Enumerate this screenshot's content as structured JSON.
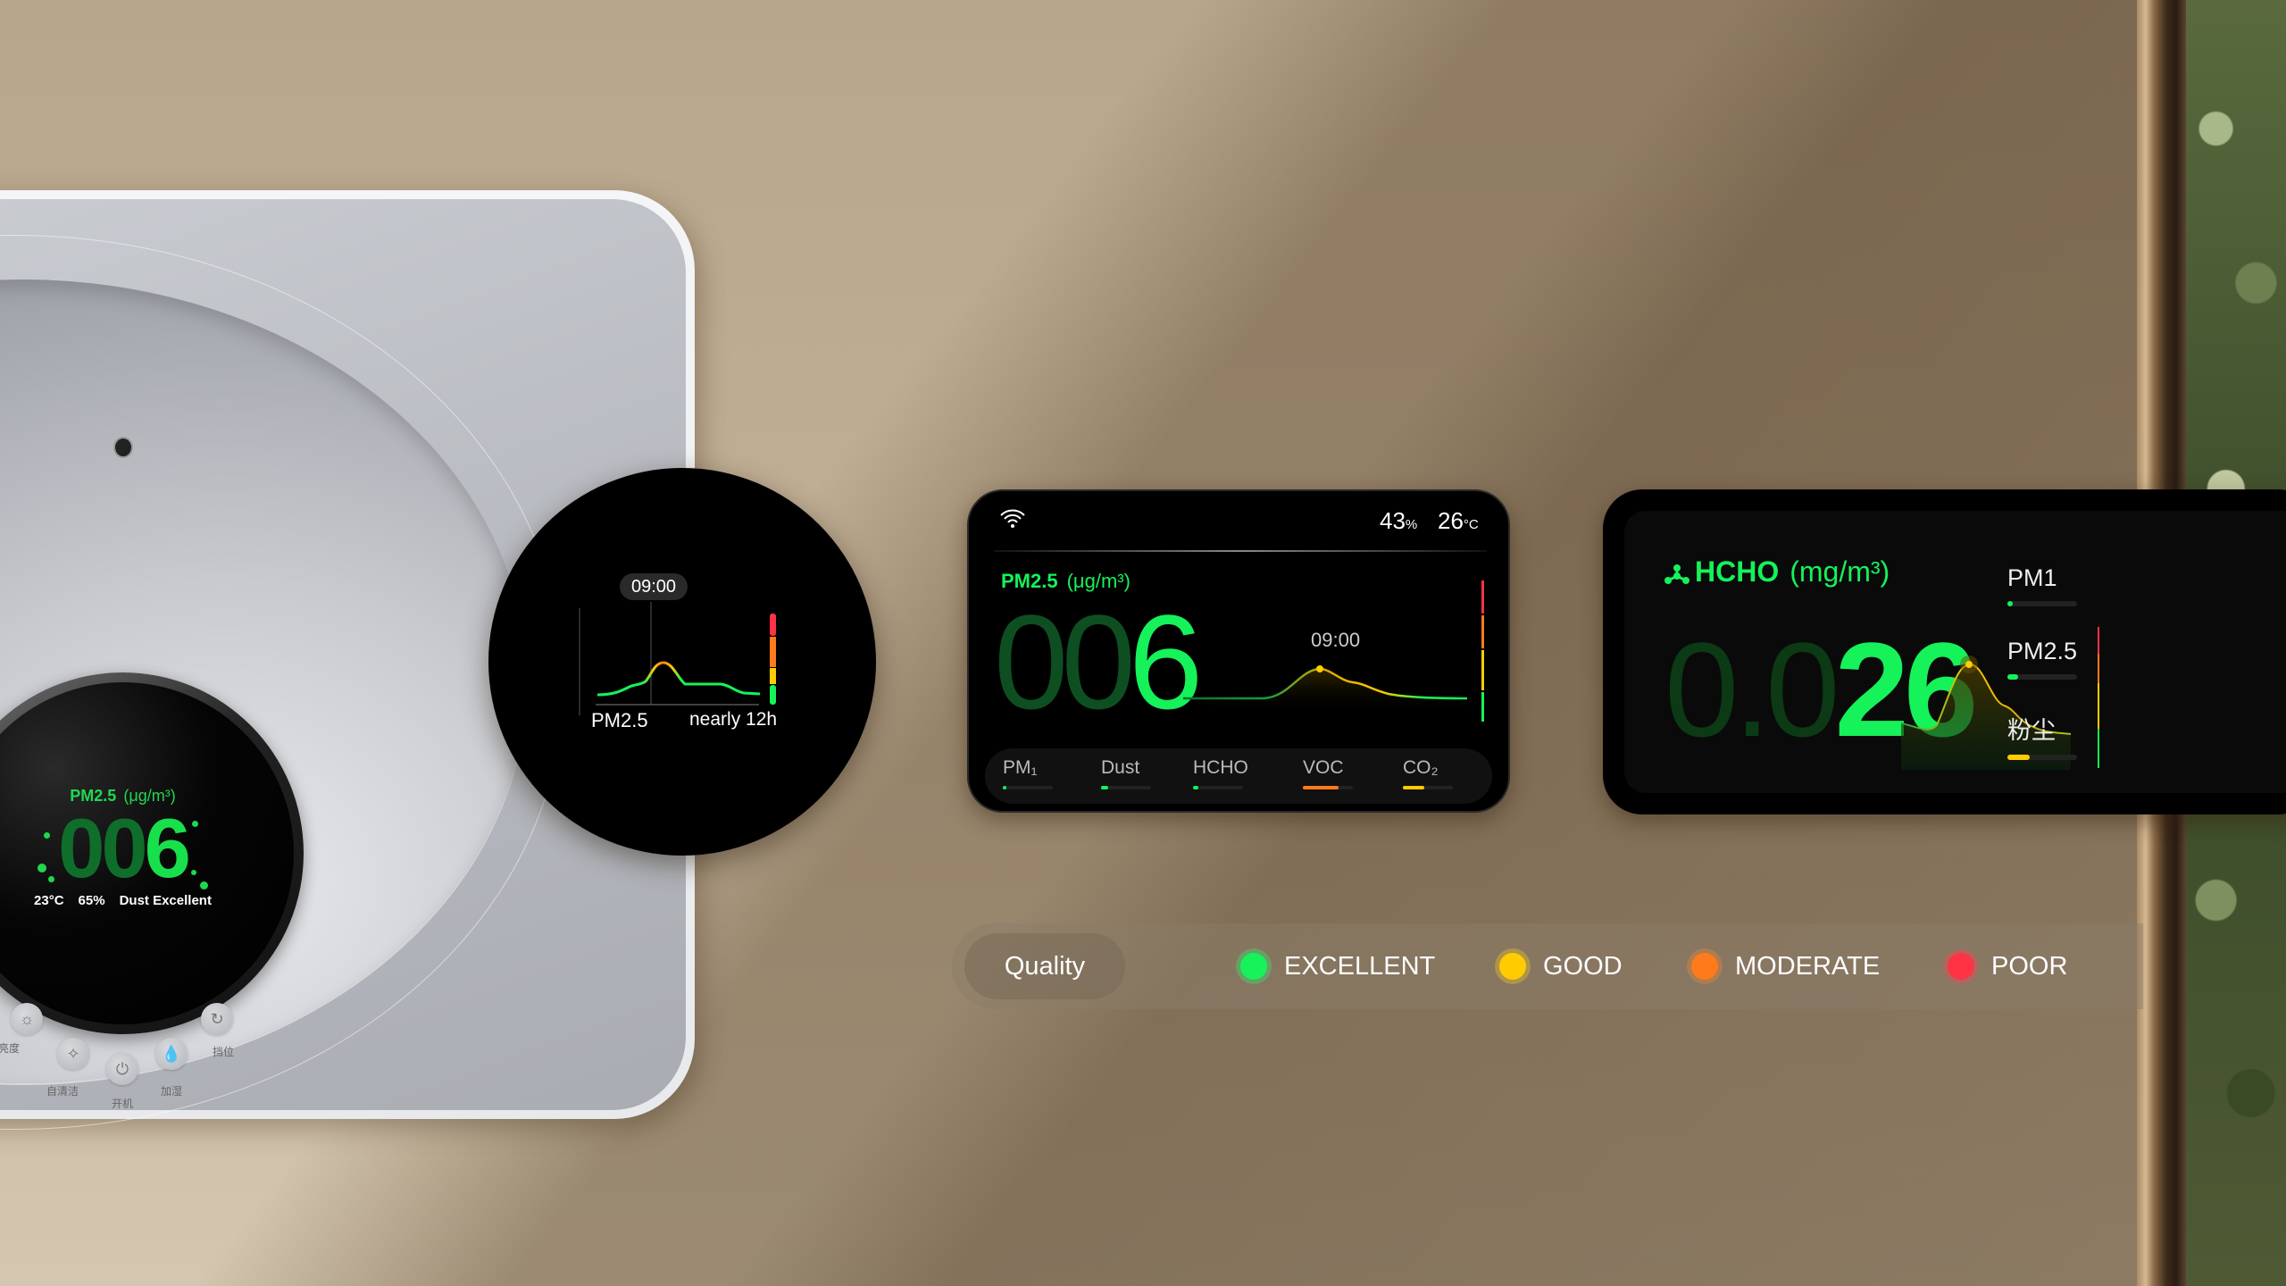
{
  "colors": {
    "excellent": "#15f25a",
    "good": "#ffcc00",
    "moderate": "#ff7a1a",
    "poor": "#ff3344",
    "value_dim": "#0e4f22"
  },
  "device": {
    "round_screen": {
      "metric": "PM2.5",
      "unit": "(μg/m³)",
      "value_dim": "00",
      "value_bright": "6",
      "temperature": "23°C",
      "humidity": "65%",
      "status": "Dust Excellent"
    },
    "buttons": [
      {
        "icon": "brightness-icon",
        "glyph": "☼",
        "label": "亮度"
      },
      {
        "icon": "self-clean-icon",
        "glyph": "✧",
        "label": "自清洁"
      },
      {
        "icon": "power-icon",
        "glyph": "⏻",
        "label": "开机"
      },
      {
        "icon": "humidify-icon",
        "glyph": "💧",
        "label": "加湿"
      },
      {
        "icon": "gear-cycle-icon",
        "glyph": "↻",
        "label": "挡位"
      }
    ]
  },
  "circle_display": {
    "time": "09:00",
    "metric": "PM2.5",
    "range": "nearly 12h",
    "scale_colors": [
      "#ff3344",
      "#ff7a1a",
      "#ffcc00",
      "#15f25a"
    ]
  },
  "rect_display": {
    "humidity": "43",
    "humidity_unit": "%",
    "temperature": "26",
    "temperature_unit": "°C",
    "metric": "PM2.5",
    "unit": "(μg/m³)",
    "value_dim": "00",
    "value_bright": "6",
    "time": "09:00",
    "tabs": [
      {
        "label": "PM₁",
        "level": 0.08,
        "color": "#15f25a"
      },
      {
        "label": "Dust",
        "level": 0.15,
        "color": "#15f25a"
      },
      {
        "label": "HCHO",
        "level": 0.1,
        "color": "#15f25a"
      },
      {
        "label": "VOC",
        "level": 0.72,
        "color": "#ff7a1a"
      },
      {
        "label": "CO₂",
        "level": 0.42,
        "color": "#ffcc00"
      }
    ]
  },
  "wide_display": {
    "metric": "HCHO",
    "unit": "(mg/m³)",
    "value_dim": "0.0",
    "value_bright": "26",
    "items": [
      {
        "label": "PM1",
        "level": 0.08,
        "color": "#15f25a"
      },
      {
        "label": "PM2.5",
        "level": 0.16,
        "color": "#15f25a"
      },
      {
        "label": "粉尘",
        "level": 0.32,
        "color": "#ffcc00"
      }
    ]
  },
  "legend": {
    "title": "Quality",
    "items": [
      {
        "label": "EXCELLENT",
        "color": "#15f25a"
      },
      {
        "label": "GOOD",
        "color": "#ffcc00"
      },
      {
        "label": "MODERATE",
        "color": "#ff7a1a"
      },
      {
        "label": "POOR",
        "color": "#ff3344"
      }
    ]
  }
}
